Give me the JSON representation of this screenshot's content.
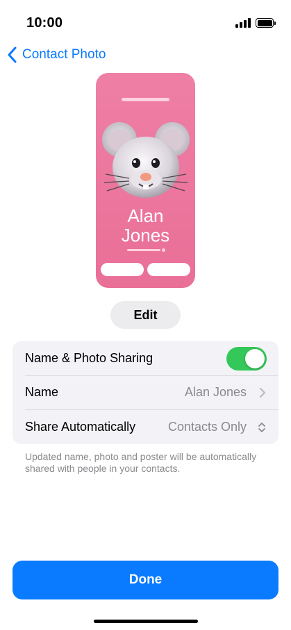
{
  "status_bar": {
    "time": "10:00"
  },
  "nav": {
    "back_label": "Contact Photo"
  },
  "poster": {
    "first_name": "Alan",
    "last_name": "Jones"
  },
  "edit_button": {
    "label": "Edit"
  },
  "settings": {
    "rows": [
      {
        "label": "Name & Photo Sharing",
        "toggle_on": true
      },
      {
        "label": "Name",
        "value": "Alan Jones"
      },
      {
        "label": "Share Automatically",
        "value": "Contacts Only"
      }
    ],
    "footnote": "Updated name, photo and poster will be automatically shared with people in your contacts."
  },
  "done_button": {
    "label": "Done"
  },
  "colors": {
    "accent": "#0a7aff",
    "toggle_on": "#34c759",
    "poster_background": "#ec779e"
  },
  "icons": [
    "signal-icon",
    "battery-icon",
    "back-chevron-icon",
    "chevron-right-icon",
    "up-down-chevron-icon",
    "memoji-mouse-icon"
  ]
}
